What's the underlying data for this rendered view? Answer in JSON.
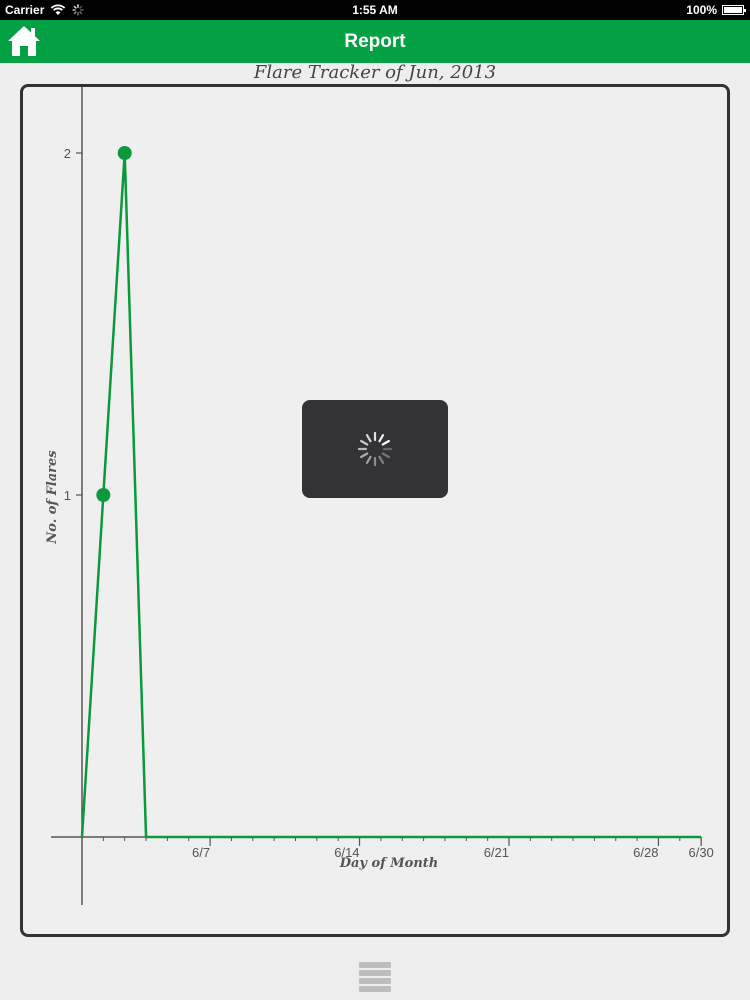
{
  "status_bar": {
    "carrier": "Carrier",
    "time": "1:55 AM",
    "battery": "100%"
  },
  "nav": {
    "title": "Report"
  },
  "chart_data": {
    "type": "line",
    "title": "Flare Tracker of Jun, 2013",
    "xlabel": "Day of Month",
    "ylabel": "No. of Flares",
    "xlim": [
      1,
      30
    ],
    "ylim": [
      0,
      2
    ],
    "y_ticks": [
      1,
      2
    ],
    "x_ticks": [
      {
        "day": 7,
        "label": "6/7"
      },
      {
        "day": 14,
        "label": "6/14"
      },
      {
        "day": 21,
        "label": "6/21"
      },
      {
        "day": 28,
        "label": "6/28"
      },
      {
        "day": 30,
        "label": "6/30"
      }
    ],
    "series": [
      {
        "x": [
          1,
          2,
          3,
          4,
          5,
          6,
          7,
          8,
          9,
          10,
          11,
          12,
          13,
          14,
          15,
          16,
          17,
          18,
          19,
          20,
          21,
          22,
          23,
          24,
          25,
          26,
          27,
          28,
          29,
          30
        ],
        "values": [
          0,
          1,
          2,
          0,
          0,
          0,
          0,
          0,
          0,
          0,
          0,
          0,
          0,
          0,
          0,
          0,
          0,
          0,
          0,
          0,
          0,
          0,
          0,
          0,
          0,
          0,
          0,
          0,
          0,
          0
        ],
        "marked": [
          2,
          3
        ]
      }
    ],
    "color": "#0a9a3c",
    "grid": false
  },
  "overlay": {
    "type": "loading-spinner"
  },
  "footer": {
    "menu_icon": "hamburger-icon"
  }
}
